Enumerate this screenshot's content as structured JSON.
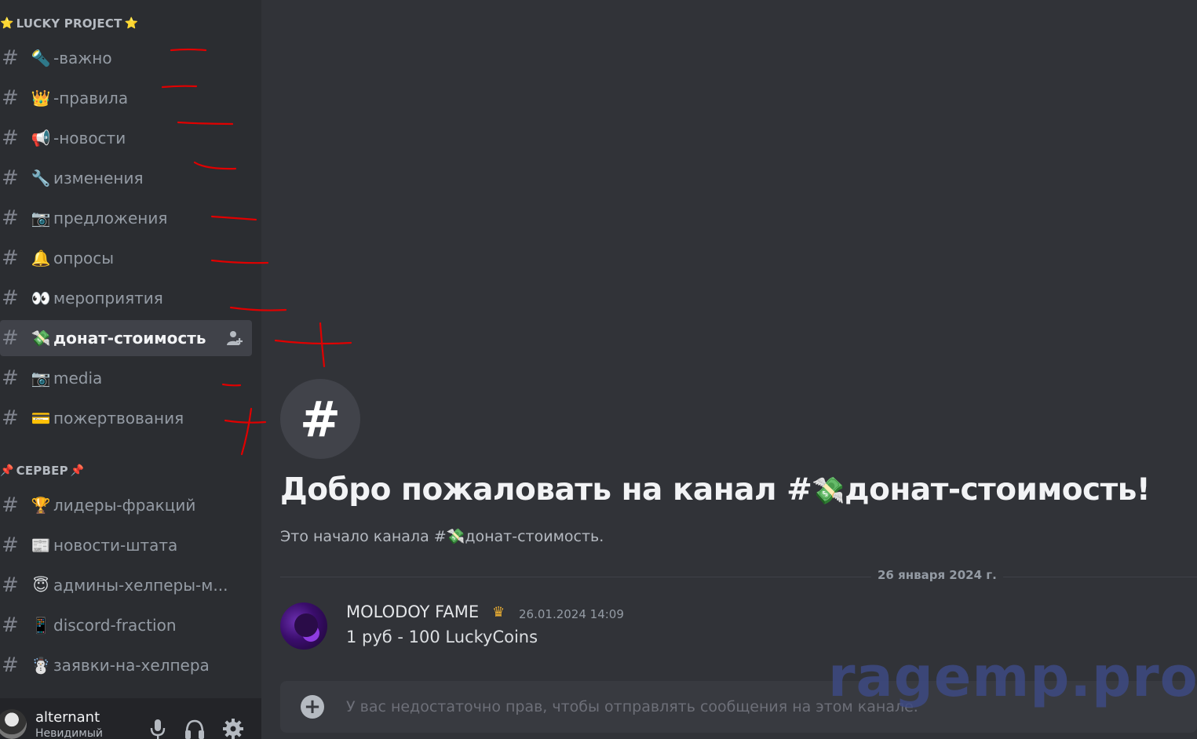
{
  "sidebar": {
    "categories": [
      {
        "emoji_left": "⭐",
        "label": "LUCKY PROJECT",
        "emoji_right": "⭐"
      },
      {
        "emoji_left": "📌",
        "label": "СЕРВЕР",
        "emoji_right": "📌"
      }
    ],
    "channels": [
      {
        "emoji": "🔦",
        "name": "-важно"
      },
      {
        "emoji": "👑",
        "name": "-правила"
      },
      {
        "emoji": "📢",
        "name": "-новости"
      },
      {
        "emoji": "🔧",
        "name": "изменения"
      },
      {
        "emoji": "📷",
        "name": "предложения"
      },
      {
        "emoji": "🔔",
        "name": "опросы"
      },
      {
        "emoji": "👀",
        "name": "мероприятия"
      },
      {
        "emoji": "💸",
        "name": "донат-стоимость",
        "active": true
      },
      {
        "emoji": "📷",
        "name": "media"
      },
      {
        "emoji": "💳",
        "name": "пожертвования"
      },
      {
        "emoji": "🏆",
        "name": "лидеры-фракций"
      },
      {
        "emoji": "📰",
        "name": "новости-штата"
      },
      {
        "emoji": "😇",
        "name": "админы-хелперы-м..."
      },
      {
        "emoji": "📱",
        "name": "discord-fraction"
      },
      {
        "emoji": "☃️",
        "name": "заявки-на-хелпера"
      }
    ]
  },
  "user_panel": {
    "username": "alternant",
    "status": "Невидимый",
    "icons": [
      "microphone-icon",
      "headphones-icon",
      "settings-gear-icon"
    ]
  },
  "main": {
    "welcome_prefix": "Добро пожаловать на канал #",
    "welcome_emoji": "💸",
    "welcome_suffix": "донат-стоимость!",
    "subtitle_prefix": "Это начало канала #",
    "subtitle_emoji": "💸",
    "subtitle_suffix": "донат-стоимость.",
    "date_divider": "26 января 2024 г.",
    "message": {
      "author": "MOLODOY FAME",
      "badge": "♛",
      "timestamp": "26.01.2024 14:09",
      "text": "1 руб - 100 LuckyCoins"
    },
    "composer_placeholder": "У вас недостаточно прав, чтобы отправлять сообщения на этом канале."
  },
  "watermark": "ragemp.pro",
  "colors": {
    "sidebar_bg": "#2b2d31",
    "main_bg": "#313338",
    "active_channel_bg": "#404249",
    "annotation_red": "#e00000",
    "watermark": "#3d4a82"
  }
}
